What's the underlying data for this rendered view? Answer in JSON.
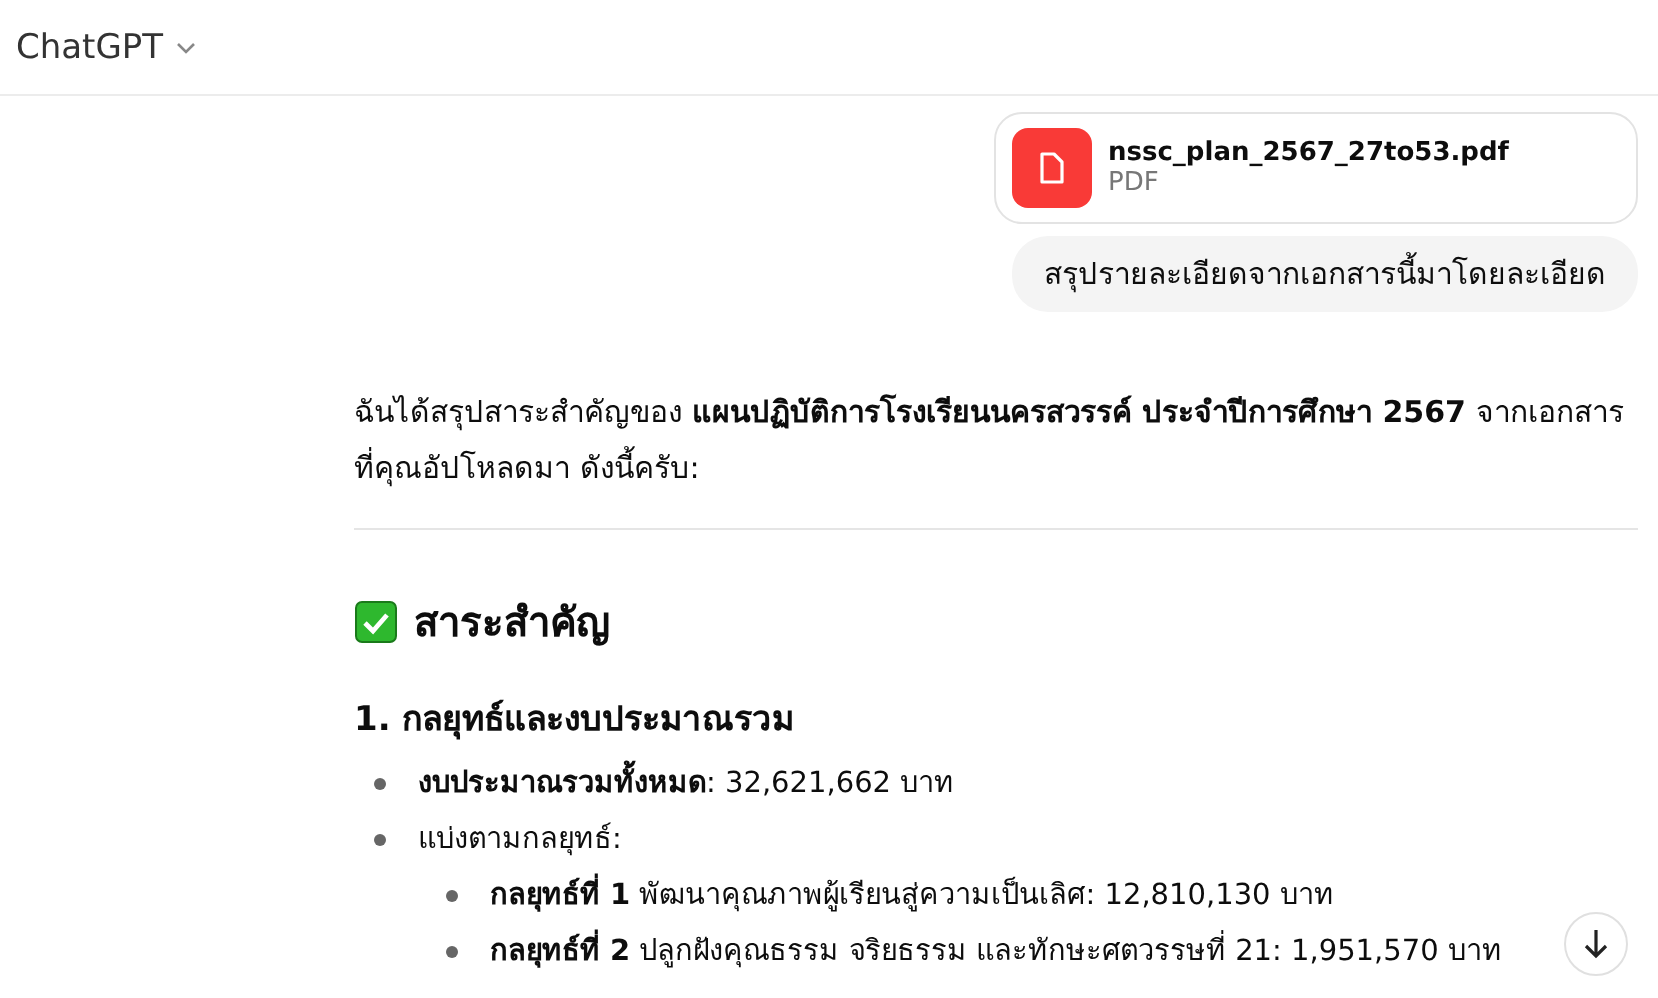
{
  "header": {
    "title": "ChatGPT"
  },
  "attachment": {
    "filename": "nssc_plan_2567_27to53.pdf",
    "filetype": "PDF"
  },
  "user_message": "สรุปรายละเอียดจากเอกสารนี้มาโดยละเอียด",
  "reply": {
    "intro": "ฉันได้สรุปสาระสำคัญของ **แผนปฏิบัติการโรงเรียนนครสวรรค์ ประจำปีการศึกษา 2567** จากเอกสารที่คุณอัปโหลดมา ดังนี้ครับ:",
    "heading": "สาระสำคัญ",
    "subheading": "1. กลยุทธ์และงบประมาณรวม",
    "bullets": [
      {
        "text": "**งบประมาณรวมทั้งหมด**: 32,621,662 บาท"
      },
      {
        "text": "แบ่งตามกลยุทธ์:",
        "children": [
          {
            "text": "**กลยุทธ์ที่ 1** พัฒนาคุณภาพผู้เรียนสู่ความเป็นเลิศ: 12,810,130 บาท"
          },
          {
            "text": "**กลยุทธ์ที่ 2** ปลูกฝังคุณธรรม จริยธรรม และทักษะศตวรรษที่ 21: 1,951,570 บาท"
          }
        ]
      }
    ]
  }
}
